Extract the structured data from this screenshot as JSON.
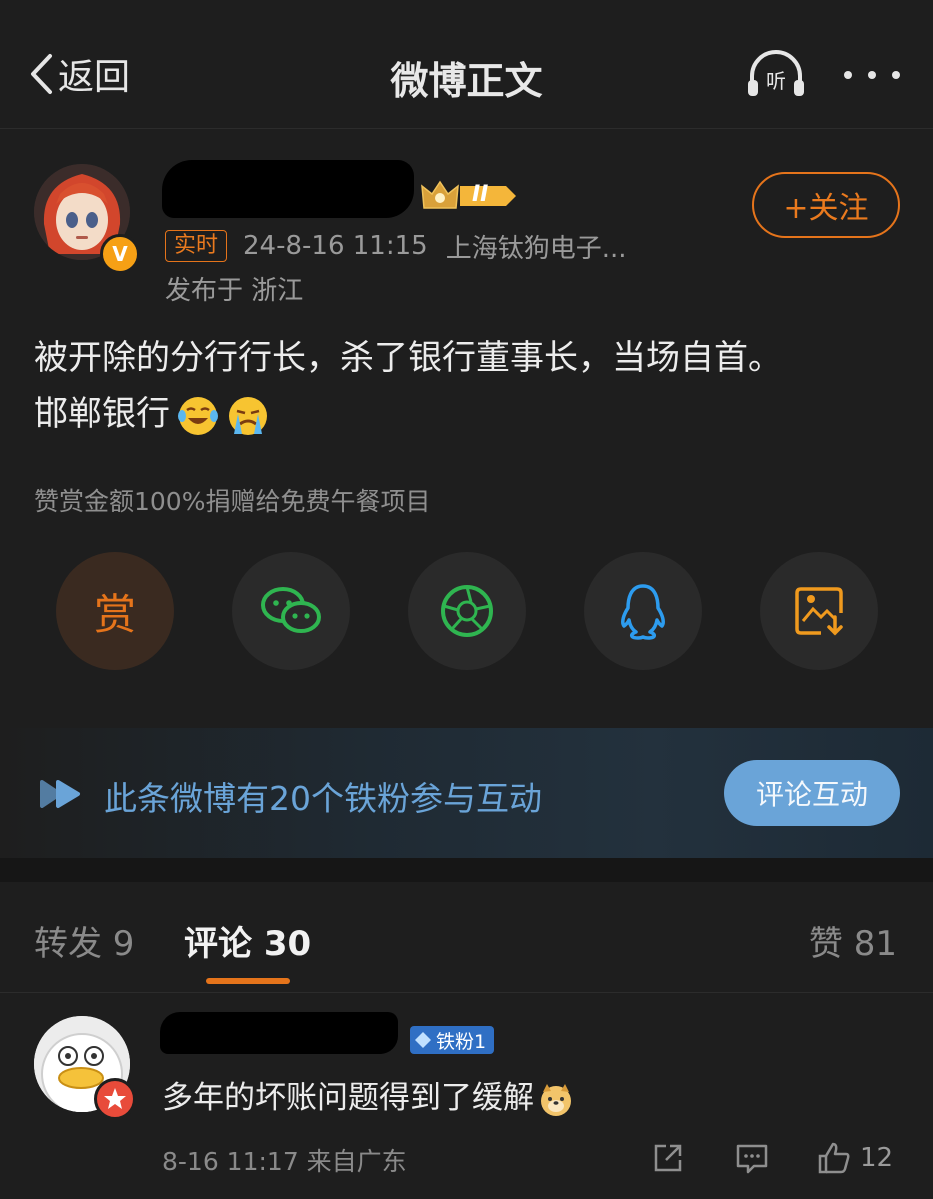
{
  "header": {
    "back_label": "返回",
    "title": "微博正文"
  },
  "post": {
    "level_badge": "II",
    "follow_label": "+关注",
    "realtime_tag": "实时",
    "time": "24-8-16 11:15",
    "source": "上海钛狗电子...",
    "location": "发布于 浙江",
    "text_line1": "被开除的分行行长，杀了银行董事长，当场自首。",
    "text_line2": "邯郸银行",
    "donate_note": "赞赏金额100%捐赠给免费午餐项目",
    "reward_label": "赏"
  },
  "banner": {
    "text": "此条微博有20个铁粉参与互动",
    "button_label": "评论互动"
  },
  "tabs": {
    "repost": "转发 9",
    "comment": "评论 30",
    "like": "赞 81"
  },
  "comment": {
    "fan_badge": "铁粉1",
    "text": "多年的坏账问题得到了缓解",
    "meta": "8-16 11:17  来自广东",
    "like_count": "12"
  },
  "colors": {
    "accent": "#e5741b",
    "blue": "#6aa4d8",
    "background": "#1e1e1e"
  }
}
